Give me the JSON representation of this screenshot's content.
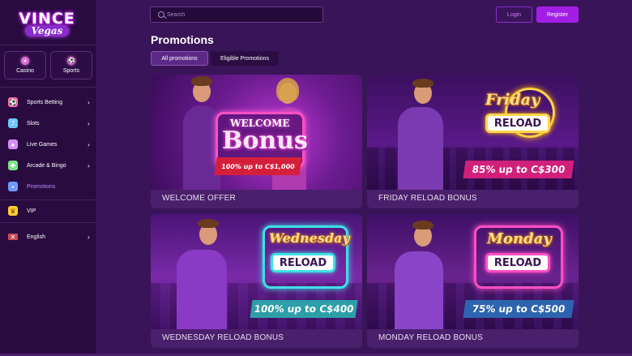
{
  "brand": {
    "logo_main": "VINCE",
    "logo_sub": "Vegas"
  },
  "quick_links": [
    {
      "label": "Casino",
      "icon": "casino-chip-icon"
    },
    {
      "label": "Sports",
      "icon": "soccer-ball-icon"
    }
  ],
  "menu": [
    {
      "label": "Sports Betting",
      "icon": "soccer-ball-icon",
      "chevron": "›",
      "icon_color": "#ff6fa8"
    },
    {
      "label": "Slots",
      "icon": "slot-machine-icon",
      "chevron": "›",
      "icon_color": "#6fc6ff"
    },
    {
      "label": "Live Games",
      "icon": "dealer-icon",
      "chevron": "›",
      "icon_color": "#d98cff"
    },
    {
      "label": "Arcade & Bingo",
      "icon": "gamepad-icon",
      "chevron": "›",
      "icon_color": "#7be38a"
    },
    {
      "label": "Promotions",
      "icon": "gift-icon",
      "chevron": "",
      "icon_color": "#6f9cff"
    },
    {
      "label": "VIP",
      "icon": "crown-icon",
      "chevron": "",
      "icon_color": "#ffcc33"
    },
    {
      "label": "English",
      "icon": "uk-flag-icon",
      "chevron": "›",
      "icon_color": "#c84a5a"
    }
  ],
  "search": {
    "placeholder": "Search"
  },
  "header": {
    "login_label": "Login",
    "register_label": "Register"
  },
  "page": {
    "title": "Promotions"
  },
  "tabs": [
    {
      "label": "All promotions",
      "active": true
    },
    {
      "label": "Eligible Promotions",
      "active": false
    }
  ],
  "promos": [
    {
      "caption": "WELCOME OFFER",
      "sign_title": "WELCOME",
      "sign_main": "Bonus",
      "offer": "100% up to C$1,000"
    },
    {
      "caption": "FRIDAY RELOAD BONUS",
      "sign_title": "Friday",
      "sign_main": "RELOAD",
      "offer": "85% up to C$300"
    },
    {
      "caption": "WEDNESDAY RELOAD BONUS",
      "sign_title": "Wednesday",
      "sign_main": "RELOAD",
      "offer": "100% up to C$400"
    },
    {
      "caption": "MONDAY RELOAD BONUS",
      "sign_title": "Monday",
      "sign_main": "RELOAD",
      "offer": "75% up to C$500"
    }
  ],
  "colors": {
    "accent": "#a31ee5",
    "sidebar_bg": "#2a0b40",
    "page_bg": "#3a1458",
    "card_bg": "#4a1f6c",
    "active_link": "#c08cff"
  }
}
